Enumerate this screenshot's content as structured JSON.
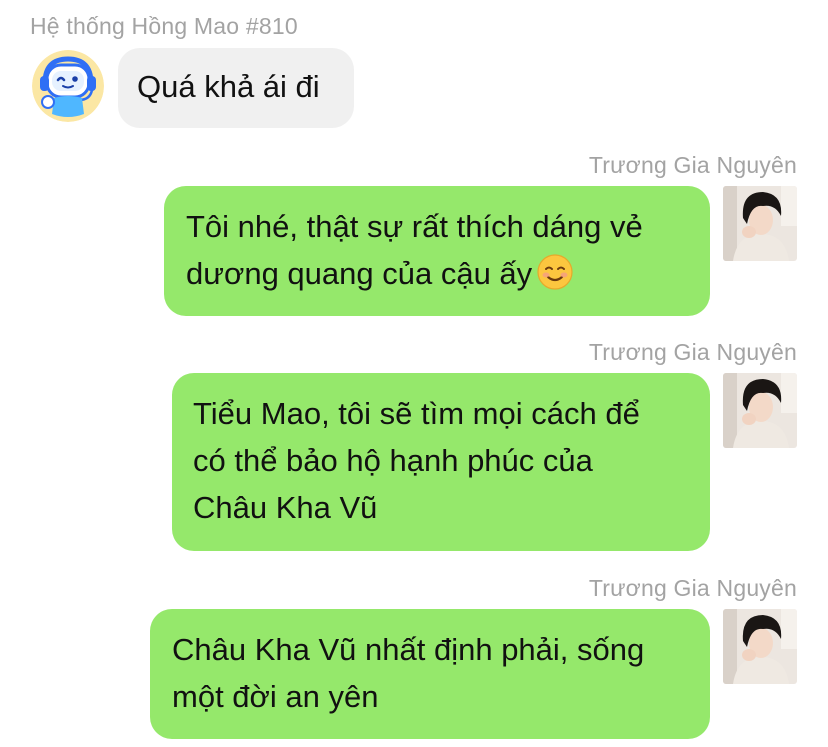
{
  "messages": [
    {
      "sender": "Hệ thống Hồng Mao #810",
      "direction": "incoming",
      "lines": [
        "Quá khả ái đi"
      ]
    },
    {
      "sender": "Trương Gia Nguyên",
      "direction": "outgoing",
      "lines": [
        "Tôi nhé, thật sự rất thích dáng vẻ",
        "dương quang của cậu ấy"
      ],
      "emoji": "smiling-face-icon"
    },
    {
      "sender": "Trương Gia Nguyên",
      "direction": "outgoing",
      "lines": [
        "Tiểu Mao, tôi sẽ tìm mọi cách để",
        "có thể bảo hộ hạnh phúc của",
        "Châu Kha Vũ"
      ]
    },
    {
      "sender": "Trương Gia Nguyên",
      "direction": "outgoing",
      "lines": [
        "Châu Kha Vũ nhất định phải, sống",
        "một đời an yên"
      ]
    }
  ],
  "colors": {
    "incoming_bubble": "#f0f0f0",
    "outgoing_bubble": "#95e86b",
    "sender_name": "#a3a3a3",
    "bot_avatar_background": "#fbe7a4",
    "bot_accent": "#2f6ff5"
  }
}
